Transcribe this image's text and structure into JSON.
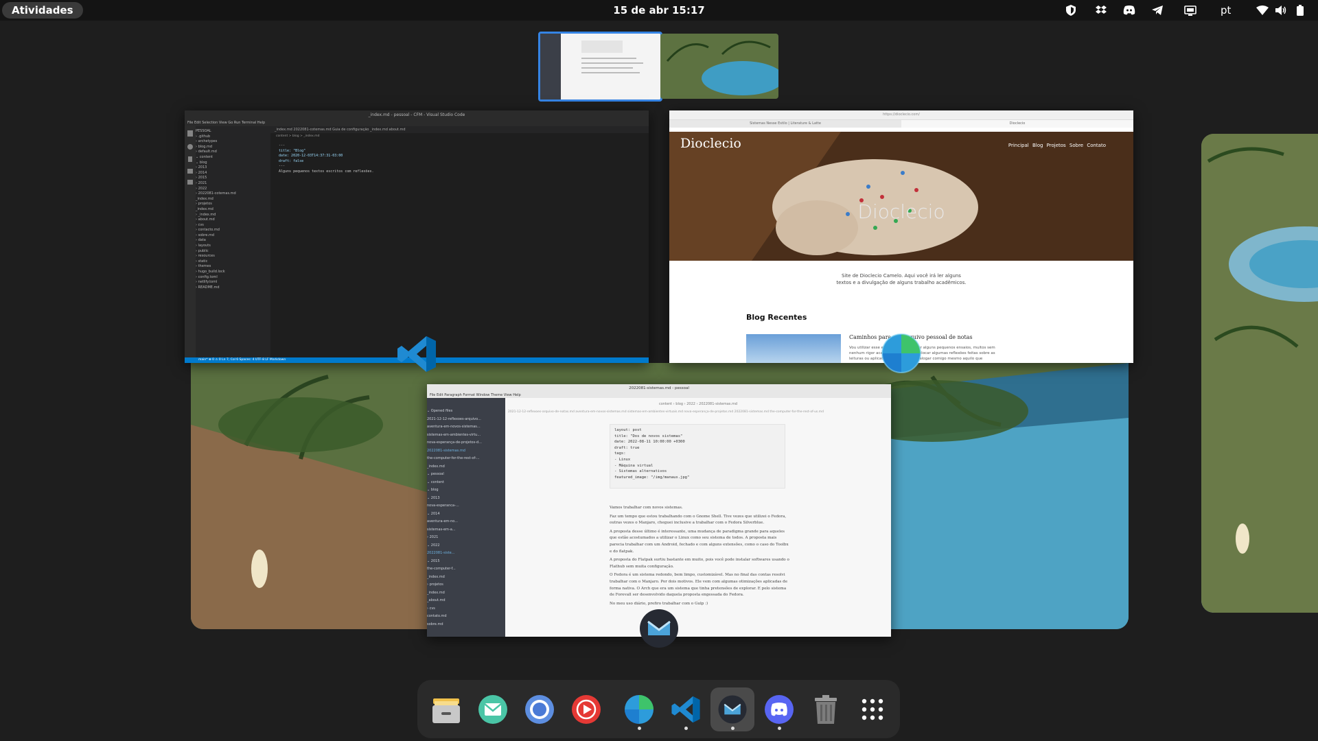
{
  "topbar": {
    "activities": "Atividades",
    "clock": "15 de abr  15:17",
    "language": "pt",
    "tray_icons": [
      "shield-icon",
      "dropbox-icon",
      "discord-icon",
      "telegram-icon",
      "screen-icon",
      "wifi-icon",
      "volume-icon",
      "battery-icon"
    ]
  },
  "windows": {
    "vscode": {
      "title": "_index.md - pessoal - CFM - Visual Studio Code",
      "menu": "File  Edit  Selection  View  Go  Run  Terminal  Help",
      "tabs": "_index.md   2022081-cotemas.md   Guia de configuração   _index.md   about.md",
      "breadcrumb": "content > blog > _index.md",
      "explorer": [
        "PESSOAL",
        "› .github",
        "› archetypes",
        "› blog.md",
        "› default.md",
        "⌄ content",
        "  ⌄ blog",
        "    › 2013",
        "    › 2014",
        "    › 2015",
        "    › 2021",
        "    › 2022",
        "    › 2022081-cotemas.md",
        "    _index.md",
        "  › projetos",
        "    _index.md",
        "  › _index.md",
        "  › about.md",
        "  › cvs",
        "  › contacto.md",
        "  › sobre.md",
        "› data",
        "› layouts",
        "› public",
        "› resources",
        "› static",
        "› themes",
        "› hugo_build.lock",
        "› config.toml",
        "› netlify.toml",
        "› README.md"
      ],
      "code": [
        "---",
        "title: \"Blog\"",
        "date: 2020-12-03T14:37:31-03:00",
        "draft: false",
        "---",
        "",
        "Alguns pequenos textos escritos com reflexões."
      ],
      "status": "main*   ⊗ 0 ⚠ 0        Ln 7, Col 6   Spaces: 4   UTF-8   LF   Markdown"
    },
    "browser": {
      "url": "https://dioclecio.com/",
      "tabs": [
        "Sistemas Nesse Estilo | Literature & Latte",
        "Dioclecio"
      ],
      "site_name": "Dioclecio",
      "nav": "Principal  Blog  Projetos  Sobre  Contato",
      "hero_title": "Dioclecio",
      "description_line1": "Site de Dioclecio Camelo. Aqui você irá ler alguns",
      "description_line2": "textos e a divulgação de alguns trabalho acadêmicos.",
      "blog_heading": "Blog Recentes",
      "post_title": "Caminhos para um arquivo pessoal de notas",
      "post_excerpt": "Vou utilizar esse espaço para escrever alguns pequenos ensaios, muitos sem nenhum rigor acadêmico. Pretendo colocar algumas reflexões feitas sobre as leituras ou aplicativos que possam dialogar comigo mesmo aquilo que"
    },
    "marktext": {
      "title": "2022081-sistemas.md - pessoal",
      "menu": "File  Edit  Paragraph  Format  Window  Theme  View  Help",
      "breadcrumb": "content › blog › 2022 › 2022081-sistemas.md",
      "tabs": "2021-12-12-reflexoes-arquivo-de-notas.md   aventura-em-novos-sistemas.md   sistemas-em-ambientes-virtuais.md   nova-esperança-de-projetos.md   2022081-sistemas.md   the-computer-for-the-rest-of-us.md",
      "sidebar": [
        "⌄ Opened files",
        "   2021-12-12-reflexoes-arquivo...",
        "   aventura-em-novos-sistemas...",
        "   sistemas-em-ambientes-virtu...",
        "   nova-esperança-de-projetos-d...",
        "   2022081-sistemas.md",
        "   the-computer-for-the-rest-of-...",
        "   _index.md",
        "⌄ pessoal",
        "  ⌄ content",
        "    ⌄ blog",
        "      ⌄ 2013",
        "          nova-esperanca-...",
        "      ⌄ 2014",
        "          aventura-em-no...",
        "          sistemas-em-a...",
        "      › 2021",
        "      ⌄ 2022",
        "          2022081-siste...",
        "      ⌄ 2015",
        "          the-computer-f...",
        "        _index.md",
        "    › projetos",
        "      _index.md",
        "      _about.md",
        "    › cvs",
        "      contato.md",
        "      sobre.md"
      ],
      "front_matter": [
        "layout: post",
        "title: \"Dos de novos sistemas\"",
        "date: 2022-08-11 10:00:00 +0300",
        "draft: true",
        "tags:",
        "  - Linux",
        "  - Máquina virtual",
        "  - Sistemas alternativos",
        "featured_image: \"/img/manaus.jpg\""
      ],
      "paragraphs": [
        "Vamos trabalhar com novos sistemas.",
        "Faz um tempo que estou trabalhando com o Gnome Shell. Tive vezes que utilizei o Fedora, outras vezes o Manjaro, cheguei inclusive a trabalhar com o Fedora Silverblue.",
        "A proposta desse último é interessante, uma mudança de paradigma grande para aqueles que estão acostumados a utilizar o Linux como seu sistema de todos. A proposta mais parecia trabalhar com um Android, fechado e com alguns extensões, como o caso do Toolbx e do flatpak.",
        "A proposta do Flatpak surtiu bastante em muito, pois você pode instalar softwares usando o Flathub sem muita configuração.",
        "O Fedora é um sistema redondo, bem limpo, customizável. Mas no final das contas resolvi trabalhar com o Manjaro. Por dois motivos. Ele vem com algumas otimizações aplicadas de forma nativa. O Arch que era um sistema que tinha pretensões de explorar. E pelo sistema de Forevall ser desenvolvido daquela proposta engessada do Fedora.",
        "No meu uso diário, prefiro trabalhar com o Gulp :)"
      ]
    }
  },
  "dock": {
    "items": [
      {
        "name": "files-icon",
        "running": false
      },
      {
        "name": "mail-icon",
        "running": false
      },
      {
        "name": "chromium-icon",
        "running": false
      },
      {
        "name": "youtube-music-icon",
        "running": false
      },
      {
        "name": "browser-globe-icon",
        "running": true
      },
      {
        "name": "vscode-icon",
        "running": true
      },
      {
        "name": "marktext-icon",
        "running": true
      },
      {
        "name": "discord-icon",
        "running": true
      },
      {
        "name": "trash-icon",
        "running": false
      },
      {
        "name": "app-grid-icon",
        "running": false
      }
    ]
  },
  "colors": {
    "accent": "#3584e4",
    "vscode_blue": "#007acc",
    "marktext_sidebar": "#3b3f48"
  }
}
